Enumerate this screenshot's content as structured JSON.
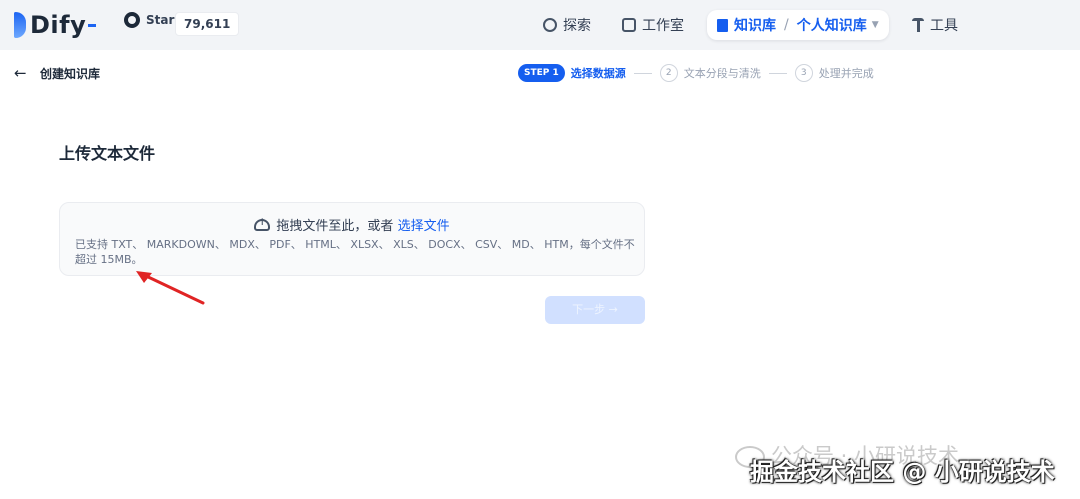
{
  "app": {
    "name": "Dify",
    "accent": "#155eef"
  },
  "github": {
    "star_label": "Star",
    "star_count": "79,611",
    "icon": "github-icon"
  },
  "nav": {
    "explore": "探索",
    "studio": "工作室",
    "knowledge": "知识库",
    "knowledge_sub": "个人知识库",
    "tools": "工具"
  },
  "page": {
    "back_title": "创建知识库",
    "heading": "上传文本文件"
  },
  "steps": [
    {
      "badge": "STEP 1",
      "label": "选择数据源",
      "active": true
    },
    {
      "num": "2",
      "label": "文本分段与清洗",
      "active": false
    },
    {
      "num": "3",
      "label": "处理并完成",
      "active": false
    }
  ],
  "upload": {
    "prompt": "拖拽文件至此，或者",
    "link": "选择文件",
    "hint": "已支持 TXT、 MARKDOWN、 MDX、 PDF、 HTML、 XLSX、 XLS、 DOCX、 CSV、 MD、 HTM，每个文件不超过 15MB。"
  },
  "next_button": "下一步 →",
  "watermark": "公众号 · 小研说技术",
  "footer_credit": "掘金技术社区 @ 小研说技术"
}
